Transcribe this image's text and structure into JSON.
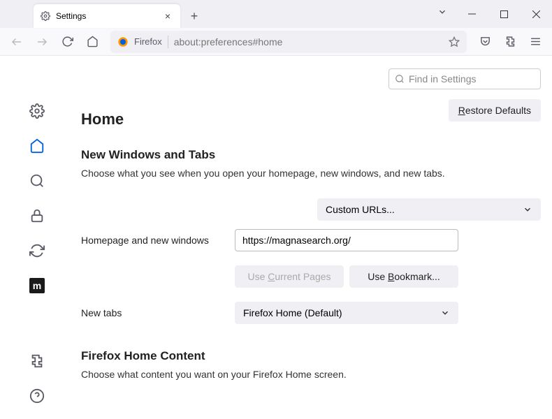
{
  "titlebar": {
    "tab_title": "Settings",
    "close_glyph": "×",
    "newtab_glyph": "+"
  },
  "toolbar": {
    "identity_label": "Firefox",
    "url": "about:preferences#home"
  },
  "search": {
    "placeholder": "Find in Settings"
  },
  "page": {
    "title": "Home",
    "restore_btn": "Restore Defaults"
  },
  "wintabs": {
    "title": "New Windows and Tabs",
    "desc": "Choose what you see when you open your homepage, new windows, and new tabs.",
    "homepage_label": "Homepage and new windows",
    "homepage_select": "Custom URLs...",
    "homepage_url": "https://magnasearch.org/",
    "use_current": "Use Current Pages",
    "use_bookmark": "Use Bookmark...",
    "newtabs_label": "New tabs",
    "newtabs_select": "Firefox Home (Default)"
  },
  "homecontent": {
    "title": "Firefox Home Content",
    "desc": "Choose what content you want on your Firefox Home screen."
  }
}
